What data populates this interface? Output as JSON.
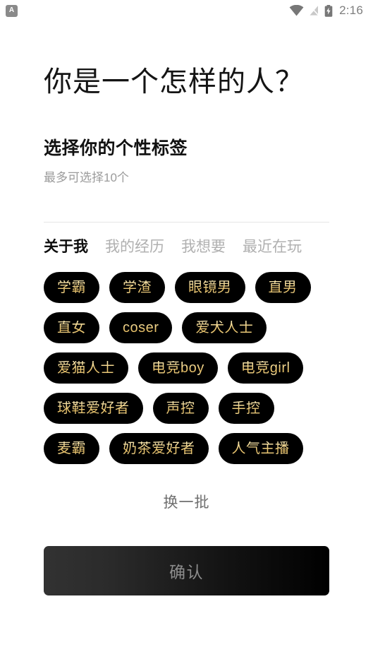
{
  "statusbar": {
    "app_badge_letter": "A",
    "icons": [
      "wifi-icon",
      "signal-off-icon",
      "battery-charging-icon"
    ],
    "time": "2:16"
  },
  "page": {
    "title": "你是一个怎样的人？",
    "section_heading": "选择你的个性标签",
    "section_subtext": "最多可选择10个"
  },
  "tabs": [
    {
      "label": "关于我",
      "active": true
    },
    {
      "label": "我的经历",
      "active": false
    },
    {
      "label": "我想要",
      "active": false
    },
    {
      "label": "最近在玩",
      "active": false
    }
  ],
  "chips": [
    {
      "label": "学霸"
    },
    {
      "label": "学渣"
    },
    {
      "label": "眼镜男"
    },
    {
      "label": "直男"
    },
    {
      "label": "直女"
    },
    {
      "label": "coser"
    },
    {
      "label": "爱犬人士"
    },
    {
      "label": "爱猫人士"
    },
    {
      "label": "电竞boy"
    },
    {
      "label": "电竞girl"
    },
    {
      "label": "球鞋爱好者"
    },
    {
      "label": "声控"
    },
    {
      "label": "手控"
    },
    {
      "label": "麦霸"
    },
    {
      "label": "奶茶爱好者"
    },
    {
      "label": "人气主播"
    }
  ],
  "actions": {
    "refresh_label": "换一批",
    "confirm_label": "确认"
  },
  "colors": {
    "chip_background": "#000000",
    "chip_text": "#eecd7b",
    "confirm_background": "#1a1a1a",
    "confirm_text": "#8d8d8d",
    "active_tab": "#0d0d0d",
    "inactive_tab": "#b0b0b0"
  }
}
